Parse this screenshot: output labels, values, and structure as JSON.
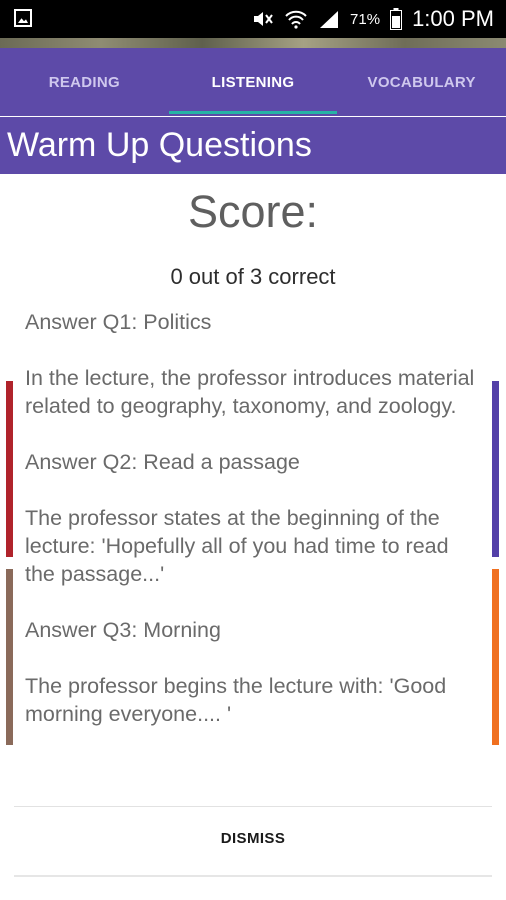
{
  "status_bar": {
    "battery": "71%",
    "time": "1:00 PM",
    "icons": [
      "gallery-icon",
      "mute-icon",
      "wifi-icon",
      "signal-icon",
      "battery-icon"
    ]
  },
  "tabs": [
    {
      "label": "READING",
      "active": false
    },
    {
      "label": "LISTENING",
      "active": true
    },
    {
      "label": "VOCABULARY",
      "active": false
    }
  ],
  "header": {
    "title": "Warm Up Questions"
  },
  "score": {
    "title": "Score:",
    "summary": "0 out of 3 correct"
  },
  "answers": [
    {
      "label": "Answer Q1: Politics",
      "explanation": "In the lecture, the professor introduces material related to geography, taxonomy, and zoology."
    },
    {
      "label": "Answer Q2: Read a passage",
      "explanation": "The professor states at the beginning of the lecture: 'Hopefully all of you had time to read the passage...'"
    },
    {
      "label": "Answer Q3: Morning",
      "explanation": "The professor begins the lecture with: 'Good morning everyone.... '"
    }
  ],
  "actions": {
    "dismiss": "DISMISS"
  },
  "colors": {
    "primary": "#5d4aa8",
    "tab_indicator": "#27b3a5",
    "edge_red": "#b0232b",
    "edge_brown": "#8a6a5a",
    "edge_purple": "#5340a8",
    "edge_orange": "#f07020"
  }
}
